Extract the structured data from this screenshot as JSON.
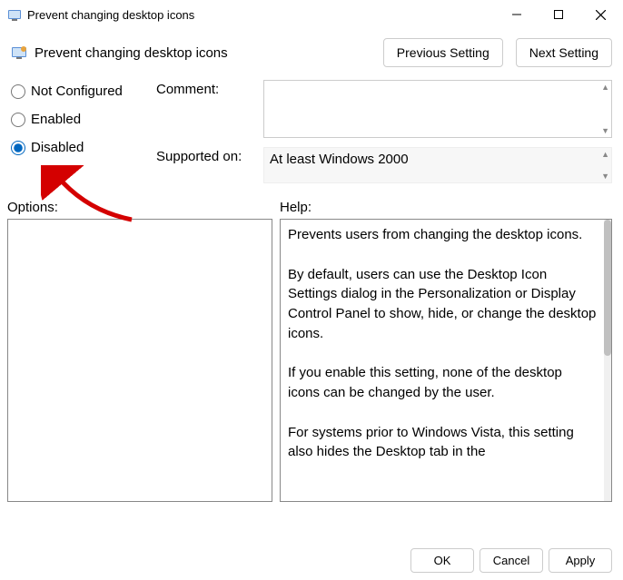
{
  "window": {
    "title": "Prevent changing desktop icons"
  },
  "header": {
    "page_title": "Prevent changing desktop icons",
    "prev_button": "Previous Setting",
    "next_button": "Next Setting"
  },
  "radios": {
    "not_configured": "Not Configured",
    "enabled": "Enabled",
    "disabled": "Disabled",
    "selected": "disabled"
  },
  "fields": {
    "comment_label": "Comment:",
    "comment_value": "",
    "supported_label": "Supported on:",
    "supported_value": "At least Windows 2000"
  },
  "sections": {
    "options_label": "Options:",
    "help_label": "Help:",
    "help_text": "Prevents users from changing the desktop icons.\n\nBy default, users can use the Desktop Icon Settings dialog in the Personalization or Display Control Panel to show, hide, or change the desktop icons.\n\nIf you enable this setting, none of the desktop icons can be changed by the user.\n\nFor systems prior to Windows Vista, this setting also hides the Desktop tab in the"
  },
  "footer": {
    "ok": "OK",
    "cancel": "Cancel",
    "apply": "Apply"
  }
}
